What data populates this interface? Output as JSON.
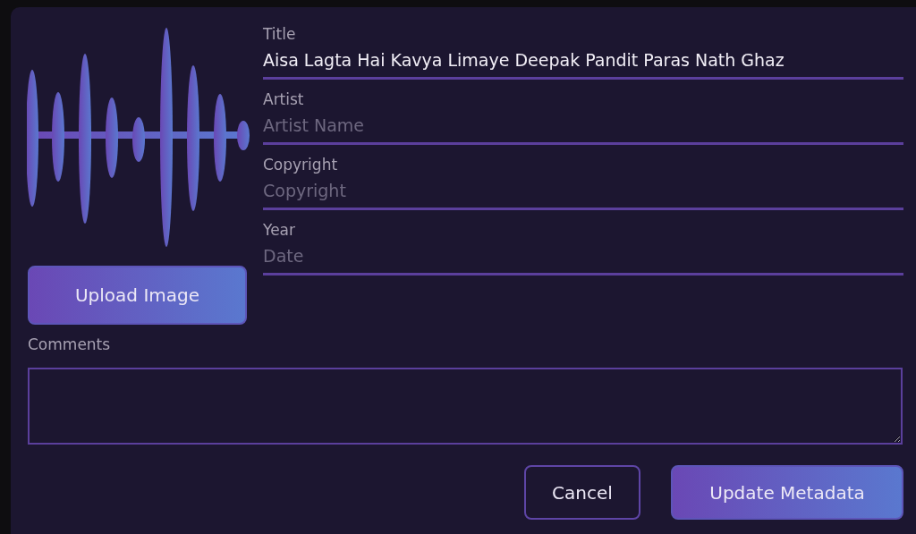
{
  "upload_button": {
    "label": "Upload Image"
  },
  "fields": [
    {
      "label": "Title",
      "value": "Aisa Lagta Hai Kavya Limaye Deepak Pandit Paras Nath Ghaz"
    },
    {
      "label": "Artist",
      "placeholder": "Artist Name"
    },
    {
      "label": "Copyright",
      "placeholder": "Copyright"
    },
    {
      "label": "Year",
      "placeholder": "Date"
    }
  ],
  "comments": {
    "label": "Comments"
  },
  "buttons": [
    {
      "label": "Cancel",
      "kind": "secondary"
    },
    {
      "label": "Update Metadata",
      "kind": "primary"
    }
  ]
}
